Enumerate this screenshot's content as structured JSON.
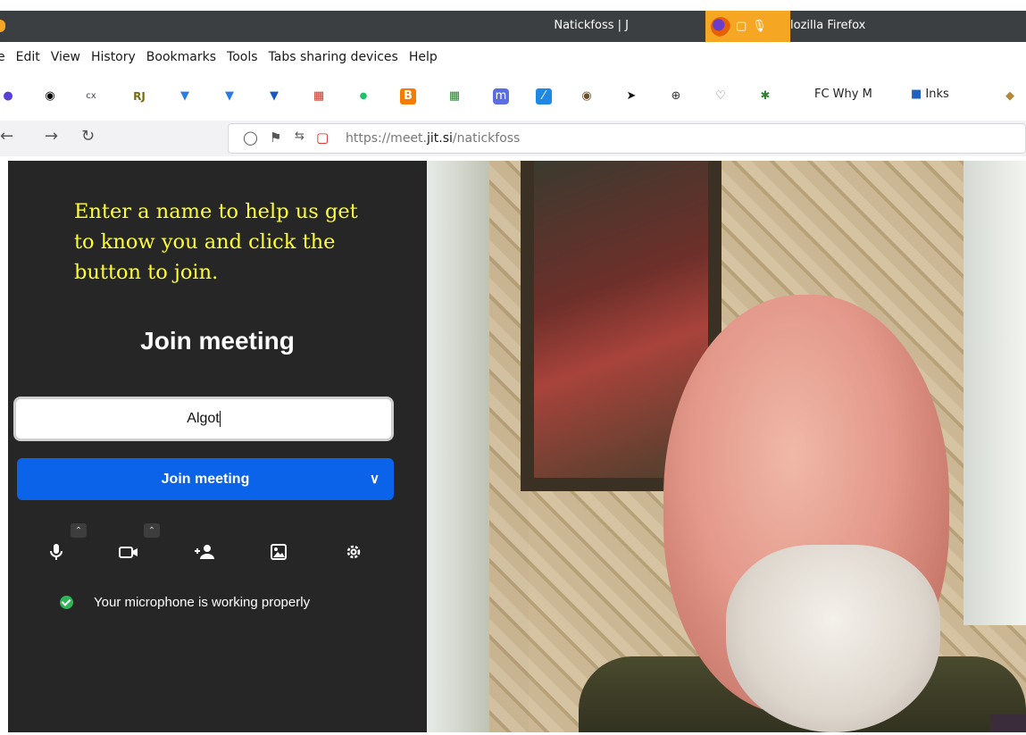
{
  "window": {
    "title_left": "Natickfoss | J",
    "title_right": "lozilla Firefox"
  },
  "menubar": {
    "items": [
      "e",
      "Edit",
      "View",
      "History",
      "Bookmarks",
      "Tools",
      "Tabs sharing devices",
      "Help"
    ]
  },
  "bookmarks": {
    "items": [
      {
        "icon": "circle-icon"
      },
      {
        "icon": "mask-icon"
      },
      {
        "icon": "cx-icon",
        "text": "cx"
      },
      {
        "icon": "rj-icon",
        "text": "RJ"
      },
      {
        "icon": "shield-icon"
      },
      {
        "icon": "shield-icon"
      },
      {
        "icon": "shield-icon"
      },
      {
        "icon": "map-icon"
      },
      {
        "icon": "dot-icon"
      },
      {
        "icon": "blogger-icon"
      },
      {
        "icon": "grid-icon"
      },
      {
        "icon": "mastodon-icon"
      },
      {
        "icon": "note-icon"
      },
      {
        "icon": "palette-icon"
      },
      {
        "icon": "bird-icon"
      },
      {
        "icon": "globe-icon"
      },
      {
        "icon": "heart-icon"
      },
      {
        "icon": "feather-icon"
      }
    ],
    "text_items": [
      "FC Why M",
      "Inks"
    ]
  },
  "navbar": {
    "url_prefix": "https://meet.",
    "url_host": "jit.si",
    "url_path": "/natickfoss"
  },
  "prejoin": {
    "tutorial_note": "Enter a name to help us get to know you and click the button to join.",
    "title": "Join meeting",
    "name_value": "Algot",
    "join_label": "Join meeting",
    "mic_status": "Your microphone is working properly"
  },
  "colors": {
    "panel_bg": "#262626",
    "join_button": "#0b63ea",
    "note_text": "#ffff33",
    "share_indicator": "#f5a623",
    "status_ok": "#2fb457"
  }
}
